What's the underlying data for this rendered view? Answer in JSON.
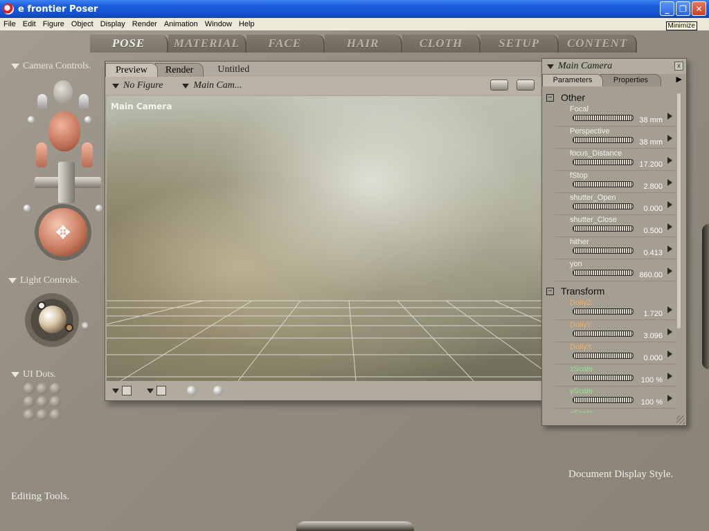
{
  "window": {
    "title": "e frontier Poser",
    "tooltip": "Minimize",
    "buttons": {
      "minimize": "_",
      "restore": "❐",
      "close": "✕"
    }
  },
  "menu": [
    "File",
    "Edit",
    "Figure",
    "Object",
    "Display",
    "Render",
    "Animation",
    "Window",
    "Help"
  ],
  "rooms": [
    "POSE",
    "MATERIAL",
    "FACE",
    "HAIR",
    "CLOTH",
    "SETUP",
    "CONTENT"
  ],
  "left": {
    "camera_controls": "Camera Controls.",
    "light_controls": "Light Controls.",
    "ui_dots": "UI Dots.",
    "editing_tools": "Editing Tools."
  },
  "document": {
    "tabs": [
      "Preview",
      "Render"
    ],
    "title": "Untitled",
    "figure_menu": "No Figure",
    "camera_menu": "Main Cam...",
    "viewport_label": "Main Camera",
    "display_style": "Document Display Style."
  },
  "params": {
    "title": "Main Camera",
    "close": "x",
    "tabs": [
      "Parameters",
      "Properties"
    ],
    "groups": [
      {
        "name": "Other",
        "toggle": "−",
        "rows": [
          {
            "name": "Focal",
            "value": "38 mm",
            "color": "white"
          },
          {
            "name": "Perspective",
            "value": "38 mm",
            "color": "white"
          },
          {
            "name": "focus_Distance",
            "value": "17.200",
            "color": "white"
          },
          {
            "name": "fStop",
            "value": "2.800",
            "color": "white"
          },
          {
            "name": "shutter_Open",
            "value": "0.000",
            "color": "white"
          },
          {
            "name": "shutter_Close",
            "value": "0.500",
            "color": "white"
          },
          {
            "name": "hither",
            "value": "0.413",
            "color": "white"
          },
          {
            "name": "yon",
            "value": "860.00",
            "color": "white"
          }
        ]
      },
      {
        "name": "Transform",
        "toggle": "−",
        "rows": [
          {
            "name": "DollyZ",
            "value": "1.720",
            "color": "orange"
          },
          {
            "name": "DollyY",
            "value": "3.096",
            "color": "orange"
          },
          {
            "name": "DollyX",
            "value": "0.000",
            "color": "orange"
          },
          {
            "name": "zScale",
            "value": "100 %",
            "color": "green"
          },
          {
            "name": "yScale",
            "value": "100 %",
            "color": "green"
          },
          {
            "name": "xScale",
            "value": "",
            "color": "green"
          }
        ]
      }
    ]
  }
}
